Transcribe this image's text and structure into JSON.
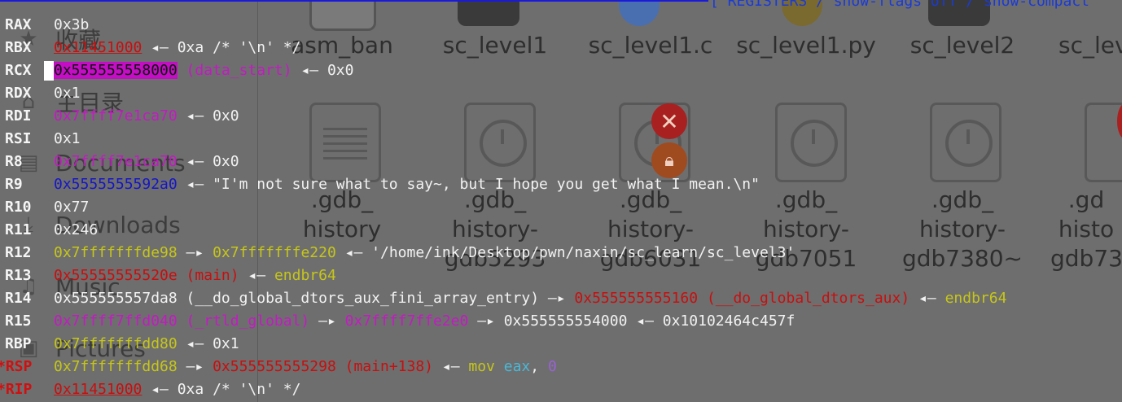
{
  "title_bar": "[ REGISTERS / show-flags off / show-compact",
  "sidebar": {
    "items": [
      {
        "label": "收藏",
        "icon": "star-icon"
      },
      {
        "label": "主目录",
        "icon": "home-icon"
      },
      {
        "label": "Documents",
        "icon": "document-icon"
      },
      {
        "label": "Downloads",
        "icon": "download-icon"
      },
      {
        "label": "Music",
        "icon": "music-icon"
      },
      {
        "label": "Pictures",
        "icon": "pictures-icon"
      }
    ]
  },
  "files": {
    "top_row": [
      "asm_ban",
      "sc_level1",
      "sc_level1.c",
      "sc_level1.py",
      "sc_level2",
      "sc_lev"
    ],
    "second_row": [
      ".gdb_\nhistory",
      ".gdb_\nhistory-\ngdb5293",
      ".gdb_\nhistory-\ngdb6031",
      ".gdb_\nhistory-\ngdb7051",
      ".gdb_\nhistory-\ngdb7380~",
      ".gd\nhisto\ngdb73"
    ]
  },
  "registers": [
    {
      "name": "RAX",
      "changed": false,
      "parts": [
        {
          "t": "0x3b",
          "c": "wht"
        }
      ]
    },
    {
      "name": "RBX",
      "changed": false,
      "parts": [
        {
          "t": "0x11451000",
          "c": "red ul"
        },
        {
          "t": " ◂— 0xa /* '\\n' */",
          "c": "wht"
        }
      ]
    },
    {
      "name": "RCX",
      "changed": false,
      "parts": [
        {
          "t": "0x555555558000",
          "c": "hl"
        },
        {
          "t": " (data_start)",
          "c": "mag"
        },
        {
          "t": " ◂— 0x0",
          "c": "wht"
        }
      ]
    },
    {
      "name": "RDX",
      "changed": false,
      "parts": [
        {
          "t": "0x1",
          "c": "wht"
        }
      ]
    },
    {
      "name": "RDI",
      "changed": false,
      "parts": [
        {
          "t": "0x7ffff7e1ca70",
          "c": "mag"
        },
        {
          "t": " ◂— 0x0",
          "c": "wht"
        }
      ]
    },
    {
      "name": "RSI",
      "changed": false,
      "parts": [
        {
          "t": "0x1",
          "c": "wht"
        }
      ]
    },
    {
      "name": "R8",
      "changed": false,
      "parts": [
        {
          "t": "0x7ffff7e1ca70",
          "c": "mag"
        },
        {
          "t": " ◂— 0x0",
          "c": "wht"
        }
      ]
    },
    {
      "name": "R9",
      "changed": false,
      "parts": [
        {
          "t": "0x5555555592a0",
          "c": "blu"
        },
        {
          "t": " ◂— \"I'm not sure what to say~, but I hope you get what I mean.\\n\"",
          "c": "wht"
        }
      ]
    },
    {
      "name": "R10",
      "changed": false,
      "parts": [
        {
          "t": "0x77",
          "c": "wht"
        }
      ]
    },
    {
      "name": "R11",
      "changed": false,
      "parts": [
        {
          "t": "0x246",
          "c": "wht"
        }
      ]
    },
    {
      "name": "R12",
      "changed": false,
      "parts": [
        {
          "t": "0x7fffffffde98",
          "c": "yel"
        },
        {
          "t": " —▸ ",
          "c": "wht"
        },
        {
          "t": "0x7fffffffe220",
          "c": "yel"
        },
        {
          "t": " ◂— '/home/ink/Desktop/pwn/naxin/sc_learn/sc_level3'",
          "c": "wht"
        }
      ]
    },
    {
      "name": "R13",
      "changed": false,
      "parts": [
        {
          "t": "0x55555555520e (main)",
          "c": "red"
        },
        {
          "t": " ◂— ",
          "c": "wht"
        },
        {
          "t": "endbr64",
          "c": "yel"
        }
      ]
    },
    {
      "name": "R14",
      "changed": false,
      "parts": [
        {
          "t": "0x555555557da8 (__do_global_dtors_aux_fini_array_entry) —▸ ",
          "c": "wht"
        },
        {
          "t": "0x555555555160 (__do_global_dtors_aux)",
          "c": "red"
        },
        {
          "t": " ◂— ",
          "c": "wht"
        },
        {
          "t": "endbr64",
          "c": "yel"
        }
      ]
    },
    {
      "name": "R15",
      "changed": false,
      "parts": [
        {
          "t": "0x7ffff7ffd040 (_rtld_global)",
          "c": "mag"
        },
        {
          "t": " —▸ ",
          "c": "wht"
        },
        {
          "t": "0x7ffff7ffe2e0",
          "c": "mag"
        },
        {
          "t": " —▸ 0x555555554000 ◂— 0x10102464c457f",
          "c": "wht"
        }
      ]
    },
    {
      "name": "RBP",
      "changed": false,
      "parts": [
        {
          "t": "0x7fffffffdd80",
          "c": "yel"
        },
        {
          "t": " ◂— 0x1",
          "c": "wht"
        }
      ]
    },
    {
      "name": "*RSP",
      "changed": true,
      "parts": [
        {
          "t": "0x7fffffffdd68",
          "c": "yel"
        },
        {
          "t": " —▸ ",
          "c": "wht"
        },
        {
          "t": "0x555555555298 (main+138)",
          "c": "red"
        },
        {
          "t": " ◂— ",
          "c": "wht"
        },
        {
          "t": "mov",
          "c": "yel"
        },
        {
          "t": " ",
          "c": "wht"
        },
        {
          "t": "eax",
          "c": "cya"
        },
        {
          "t": ", ",
          "c": "wht"
        },
        {
          "t": "0",
          "c": "pur"
        }
      ]
    },
    {
      "name": "*RIP",
      "changed": true,
      "parts": [
        {
          "t": "0x11451000",
          "c": "red ul"
        },
        {
          "t": " ◂— 0xa /* '\\n' */",
          "c": "wht"
        }
      ]
    }
  ]
}
